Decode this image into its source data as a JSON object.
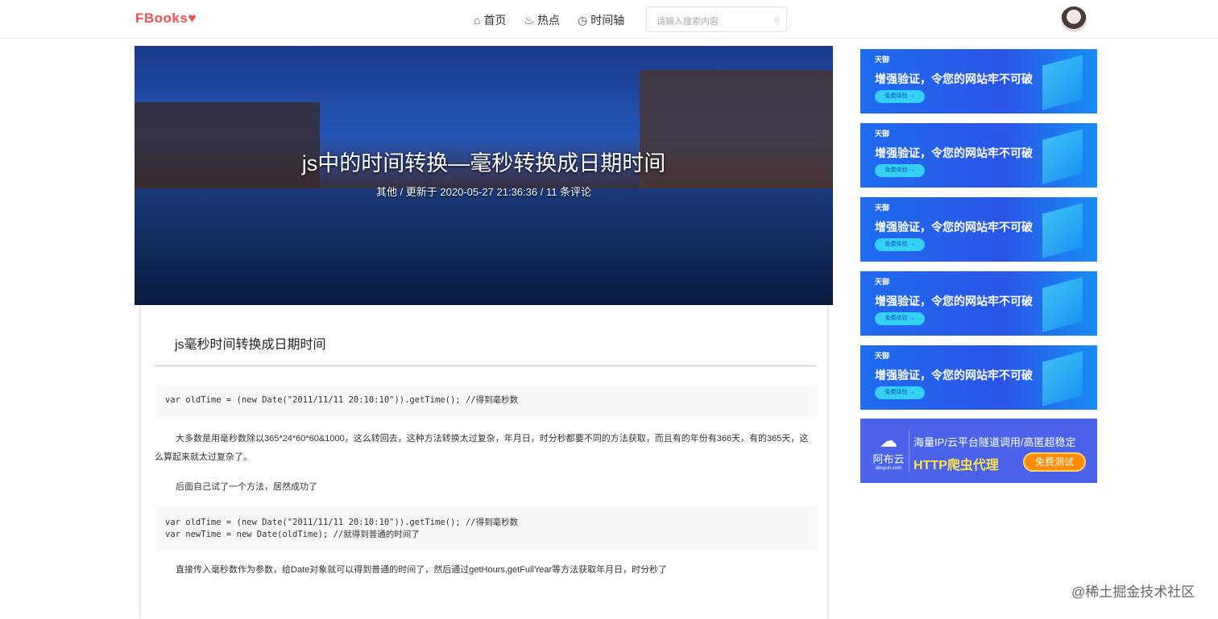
{
  "header": {
    "logo": "FBooks♥",
    "nav": [
      {
        "icon": "home-icon",
        "label": "首页"
      },
      {
        "icon": "fire-icon",
        "label": "热点"
      },
      {
        "icon": "clock-icon",
        "label": "时间轴"
      }
    ],
    "search_placeholder": "请输入搜索内容"
  },
  "hero": {
    "title": "js中的时间转换—毫秒转换成日期时间",
    "meta": "其他 / 更新于 2020-05-27 21:36:36 / 11 条评论"
  },
  "article": {
    "heading": "js毫秒时间转换成日期时间",
    "code1": "var oldTime = (new Date(\"2011/11/11 20:10:10\")).getTime(); //得到毫秒数",
    "p1": "大多数是用毫秒数除以365*24*60*60&1000，这么转回去，这种方法转换太过复杂，年月日，时分秒都要不同的方法获取，而且有的年份有366天，有的365天，这么算起来就太过复杂了。",
    "p2": "后面自己试了一个方法，居然成功了",
    "code2": [
      "var oldTime = (new Date(\"2011/11/11 20:10:10\")).getTime(); //得到毫秒数",
      "var newTime = new Date(oldTime); //就得到普通的时间了"
    ],
    "p3": "直接传入毫秒数作为参数，给Date对象就可以得到普通的时间了，然后通过getHours,getFullYear等方法获取年月日，时分秒了"
  },
  "sidebar": {
    "ad": {
      "brand": "天御",
      "title": "增强验证，令您的网站牢不可破",
      "button": "免费体验 →"
    },
    "ad2": {
      "brand": "阿布云",
      "domain": "abuyun.com",
      "line1": "海量IP/云平台隧道调用/高匿超稳定",
      "line2": "HTTP爬虫代理",
      "button": "免费测试"
    }
  },
  "watermark": "@稀土掘金技术社区"
}
